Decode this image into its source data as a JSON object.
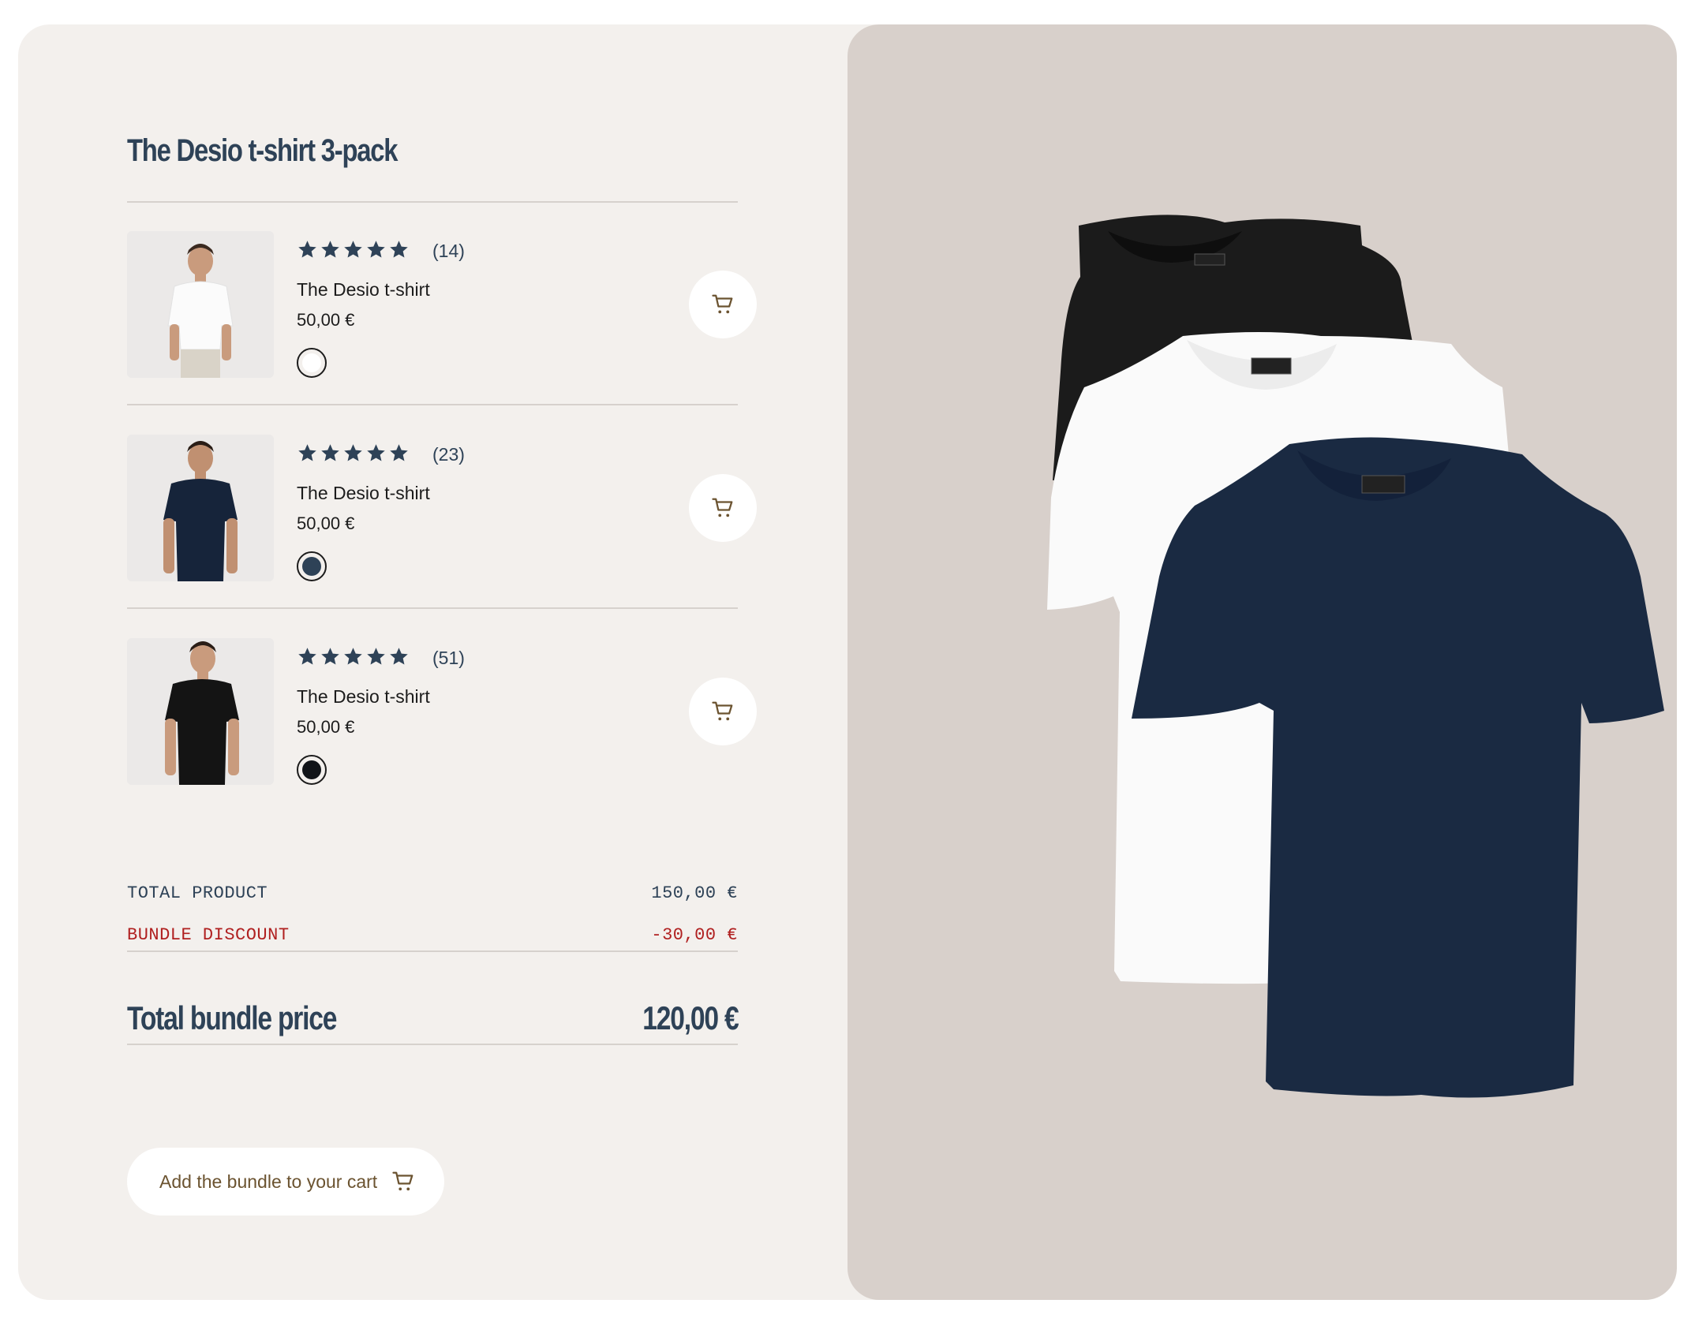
{
  "bundle": {
    "title": "The Desio t-shirt 3-pack",
    "items": [
      {
        "rating_count": "(14)",
        "name": "The Desio t-shirt",
        "price": "50,00 €",
        "color": "#ffffff",
        "shirt_color": "#ffffff",
        "stars": 5
      },
      {
        "rating_count": "(23)",
        "name": "The Desio t-shirt",
        "price": "50,00 €",
        "color": "#2e4257",
        "shirt_color": "#15243a",
        "stars": 5
      },
      {
        "rating_count": "(51)",
        "name": "The Desio t-shirt",
        "price": "50,00 €",
        "color": "#111418",
        "shirt_color": "#151515",
        "stars": 5
      }
    ],
    "summary": {
      "total_product_label": "TOTAL PRODUCT",
      "total_product_value": "150,00 €",
      "discount_label": "BUNDLE DISCOUNT",
      "discount_value": "-30,00 €",
      "bundle_label": "Total bundle price",
      "bundle_value": "120,00 €"
    },
    "add_button_label": "Add the bundle to your cart"
  },
  "icons": {
    "star": "star-icon",
    "cart": "cart-icon"
  },
  "colors": {
    "accent": "#2e4257",
    "discount": "#b02020",
    "panel_left": "#f3f0ed",
    "panel_right": "#d8d0cb",
    "button_text": "#6b5330"
  }
}
